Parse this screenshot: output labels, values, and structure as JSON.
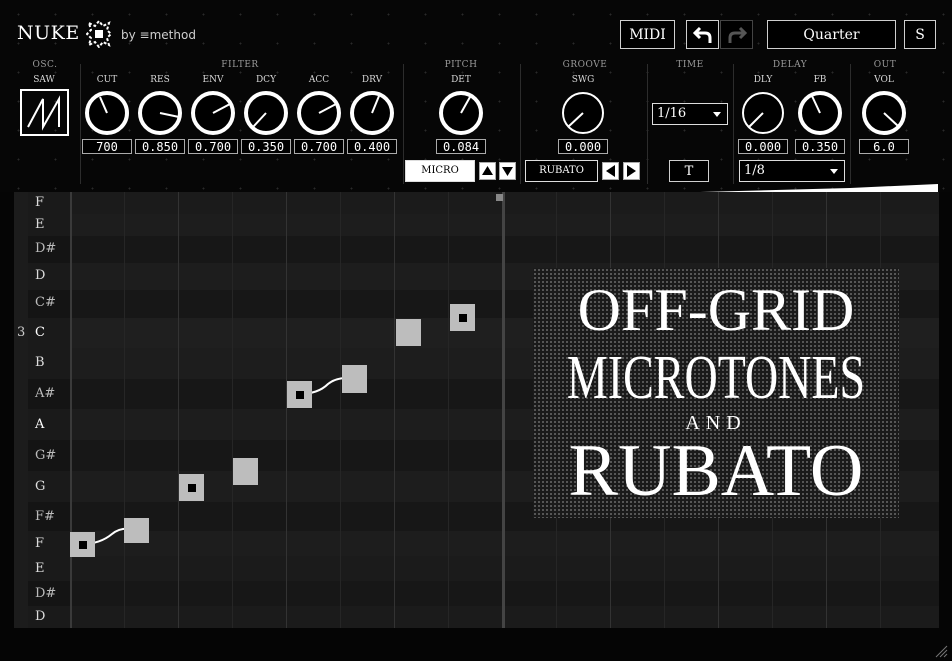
{
  "app": {
    "name": "NUKE",
    "byline": "by ≡method"
  },
  "header": {
    "midi_label": "MIDI",
    "quantize": "Quarter",
    "s_label": "S"
  },
  "sections": {
    "osc": "OSC.",
    "filter": "FILTER",
    "pitch": "PITCH",
    "groove": "GROOVE",
    "time": "TIME",
    "delay": "DELAY",
    "out": "OUT"
  },
  "osc": {
    "label": "SAW"
  },
  "knobs": [
    {
      "label": "CUT",
      "value": "700"
    },
    {
      "label": "RES",
      "value": "0.850"
    },
    {
      "label": "ENV",
      "value": "0.700"
    },
    {
      "label": "DCY",
      "value": "0.350"
    },
    {
      "label": "ACC",
      "value": "0.700"
    },
    {
      "label": "DRV",
      "value": "0.400"
    },
    {
      "label": "DET",
      "value": "0.084"
    },
    {
      "label": "SWG",
      "value": "0.000"
    },
    {
      "label": "DLY",
      "value": "0.000"
    },
    {
      "label": "FB",
      "value": "0.350"
    },
    {
      "label": "VOL",
      "value": "6.0"
    }
  ],
  "pitch": {
    "toggle": "MICRO"
  },
  "groove": {
    "toggle": "RUBATO"
  },
  "time": {
    "division": "1/16",
    "t_label": "T"
  },
  "delay": {
    "division": "1/8"
  },
  "keys": [
    "F",
    "E",
    "D#",
    "D",
    "C#",
    "C",
    "B",
    "A#",
    "A",
    "G#",
    "G",
    "F#",
    "F",
    "E",
    "D#",
    "D"
  ],
  "octave_marker": "3",
  "promo": {
    "line1": "OFF-GRID",
    "line2": "MICROTONES",
    "line3": "AND",
    "line4": "RUBATO"
  }
}
